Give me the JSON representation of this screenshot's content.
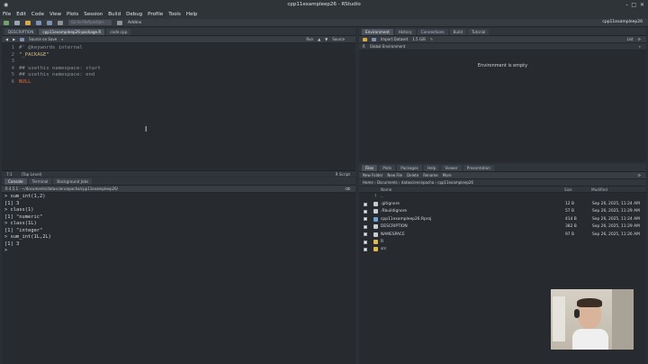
{
  "window": {
    "title": "cpp11exampleep26 - RStudio"
  },
  "menu": [
    "File",
    "Edit",
    "Code",
    "View",
    "Plots",
    "Session",
    "Build",
    "Debug",
    "Profile",
    "Tools",
    "Help"
  ],
  "toolbar": {
    "goto_placeholder": "Go to file/function",
    "addins": "Addins",
    "project": "cpp11exampleep26"
  },
  "editor": {
    "tabs": [
      "DESCRIPTION",
      "cpp11exampleep26-package.R",
      "code.cpp"
    ],
    "actions": {
      "source_on_save": "Source on Save",
      "run": "Run",
      "source": "Source"
    },
    "lines": [
      {
        "n": "1",
        "text": "#' @keywords internal",
        "cls": "cmt"
      },
      {
        "n": "2",
        "text": "\"_PACKAGE\"",
        "cls": "str"
      },
      {
        "n": "3",
        "text": "",
        "cls": ""
      },
      {
        "n": "4",
        "text": "## usethis namespace: start",
        "cls": "cmt"
      },
      {
        "n": "5",
        "text": "## usethis namespace: end",
        "cls": "cmt"
      },
      {
        "n": "6",
        "text": "NULL",
        "cls": "kw"
      }
    ],
    "status": {
      "pos": "7:1",
      "scope": "(Top Level)",
      "type": "R Script"
    }
  },
  "console": {
    "tabs": [
      "Console",
      "Terminal",
      "Background Jobs"
    ],
    "path": "R 4.5.1 · ~/documents/datasciencepacha/cpp11exampleep26/",
    "lines": [
      "> sum_int(1,2)",
      "[1] 3",
      "> class(1)",
      "[1] \"numeric\"",
      "> class(1L)",
      "[1] \"integer\"",
      "> sum_int(1L,2L)",
      "[1] 3",
      ">"
    ]
  },
  "environment": {
    "tabs": [
      "Environment",
      "History",
      "Connections",
      "Build",
      "Tutorial"
    ],
    "import": "Import Dataset",
    "memory": "1.5 GiB",
    "list": "List",
    "r_label": "R",
    "scope": "Global Environment",
    "empty_message": "Environment is empty"
  },
  "files": {
    "tabs": [
      "Files",
      "Plots",
      "Packages",
      "Help",
      "Viewer",
      "Presentation"
    ],
    "actions": {
      "new_folder": "New Folder",
      "new_file": "New File",
      "delete": "Delete",
      "rename": "Rename",
      "more": "More"
    },
    "breadcrumb": "Home › Documents › datasciencepacha › cpp11exampleep26",
    "columns": {
      "name": "Name",
      "size": "Size",
      "modified": "Modified"
    },
    "up": "..",
    "rows": [
      {
        "name": ".gitignore",
        "size": "12 B",
        "modified": "Sep 26, 2025, 11:24 AM",
        "color": "#c8ccd0"
      },
      {
        "name": ".Rbuildignore",
        "size": "57 B",
        "modified": "Sep 26, 2025, 11:29 AM",
        "color": "#c8ccd0"
      },
      {
        "name": "cpp11exampleep26.Rproj",
        "size": "414 B",
        "modified": "Sep 26, 2025, 11:24 AM",
        "color": "#6fa0d8"
      },
      {
        "name": "DESCRIPTION",
        "size": "382 B",
        "modified": "Sep 26, 2025, 11:29 AM",
        "color": "#c8ccd0"
      },
      {
        "name": "NAMESPACE",
        "size": "97 B",
        "modified": "Sep 26, 2025, 11:26 AM",
        "color": "#c8ccd0"
      },
      {
        "name": "R",
        "size": "",
        "modified": "",
        "color": "#e2b84a"
      },
      {
        "name": "src",
        "size": "",
        "modified": "",
        "color": "#e2b84a"
      }
    ]
  }
}
